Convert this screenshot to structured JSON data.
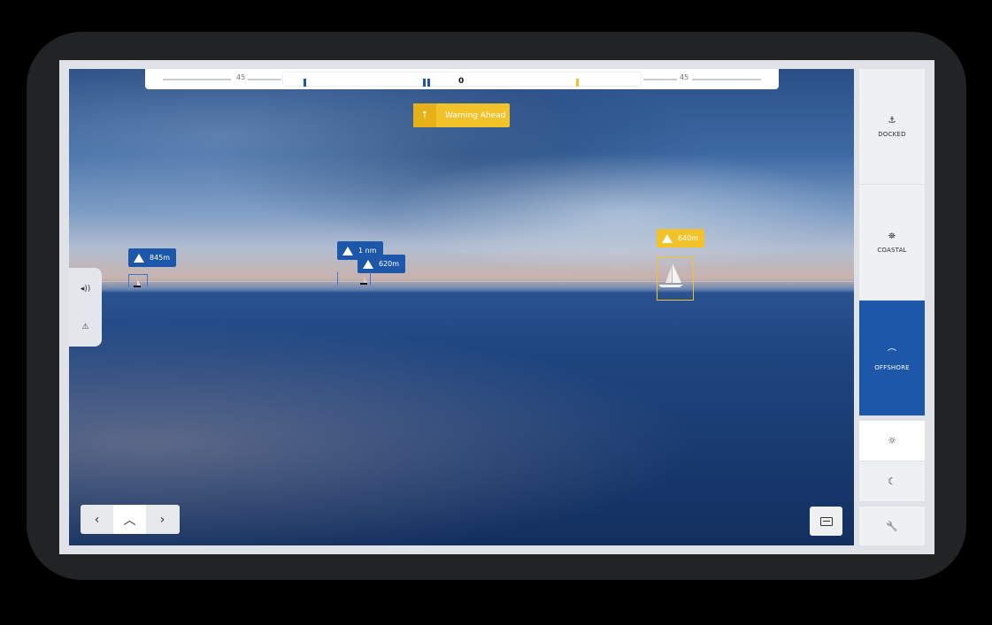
{
  "compass": {
    "left_label": "45",
    "right_label": "45",
    "center_label": "0"
  },
  "warning": {
    "label": "Warning Ahead",
    "arrow": "↑"
  },
  "targets": [
    {
      "label": "845m",
      "color": "blue"
    },
    {
      "label": "1 nm",
      "color": "blue"
    },
    {
      "label": "620m",
      "color": "blue"
    },
    {
      "label": "640m",
      "color": "yellow"
    }
  ],
  "left_panel": {
    "icons": [
      "speaker-icon",
      "warning-triangle-icon"
    ],
    "glyphs": [
      "◂))",
      "⚠"
    ]
  },
  "nav": {
    "prev": "‹",
    "up": "︿",
    "next": "›"
  },
  "modes": [
    {
      "label": "DOCKED",
      "icon": "anchor-icon",
      "glyph": "⚓",
      "active": false
    },
    {
      "label": "COASTAL",
      "icon": "lighthouse-icon",
      "glyph": "⛯",
      "active": false
    },
    {
      "label": "OFFSHORE",
      "icon": "wave-icon",
      "glyph": "⌒",
      "active": true
    }
  ],
  "theme": {
    "day_icon": "☼",
    "night_icon": "☾"
  },
  "tool_icon": "🔧",
  "colors": {
    "accent_blue": "#1c57a9",
    "warning_yellow": "#f2c22a"
  }
}
